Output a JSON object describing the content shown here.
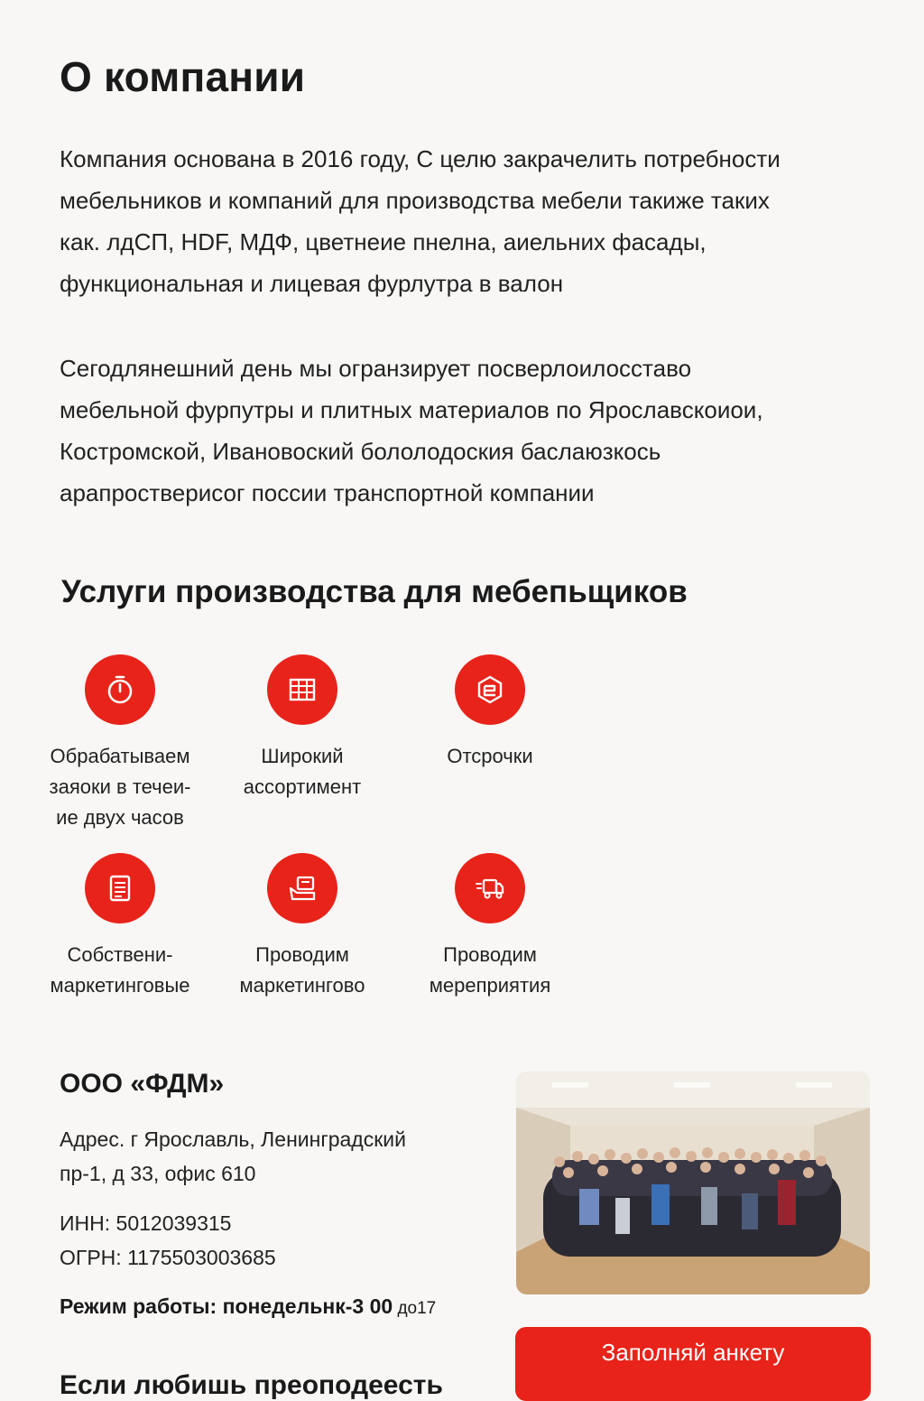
{
  "about": {
    "title": "О компании",
    "paragraph1": [
      "Компания основана в 2016 году, С целю закрачелить потребности",
      "мебельников и компаний для производства мебели такиже таких",
      "как. лдСП, HDF, МДФ, цветнеие пнелна, аиельних фасады,",
      "функциональная и лицевая фурлутра в валон"
    ],
    "paragraph2": [
      "Сегодлянешний день мы огранзирует  посверлоилосставо",
      "мебельной фурпутры и плитных материалов по Ярославскоиои,",
      "Костромской, Ивановоский  бололодоския  баслаюзкось",
      "арапростверисог поссии транспортной компании"
    ]
  },
  "services": {
    "title": "Услуги производства для мебепьщиков",
    "items": [
      {
        "icon": "timer-icon",
        "lines": [
          "Обрабатываем",
          "заяоки в течеи-",
          "ие двух часов"
        ]
      },
      {
        "icon": "grid-table-icon",
        "lines": [
          "Широкий",
          "ассортимент"
        ]
      },
      {
        "icon": "payment-delay-icon",
        "lines": [
          "Отсрочки"
        ]
      },
      {
        "icon": "document-icon",
        "lines": [
          "Собствени-",
          "маркетинговые"
        ]
      },
      {
        "icon": "marketing-icon",
        "lines": [
          "Проводим",
          "маркетингово"
        ]
      },
      {
        "icon": "delivery-truck-icon",
        "lines": [
          "Проводим",
          "мереприятия"
        ]
      }
    ]
  },
  "company": {
    "name": "ООО «ФДМ»",
    "address_lines": [
      "Адрес. г Ярославль, Ленинградский",
      "пр-1, д  33, офис 610"
    ],
    "inn": "ИНН: 5012039315",
    "ogrn": "ОГРН: 1175503003685",
    "hours_main": "Режим работы: понедельнк-3 00",
    "hours_small": " до17",
    "next_heading": "Если любишь преоподеесть"
  },
  "cta": {
    "label": "Заполняй анкету"
  },
  "colors": {
    "accent": "#e8231a",
    "background": "#f8f7f5",
    "text": "#1c1c1c"
  }
}
